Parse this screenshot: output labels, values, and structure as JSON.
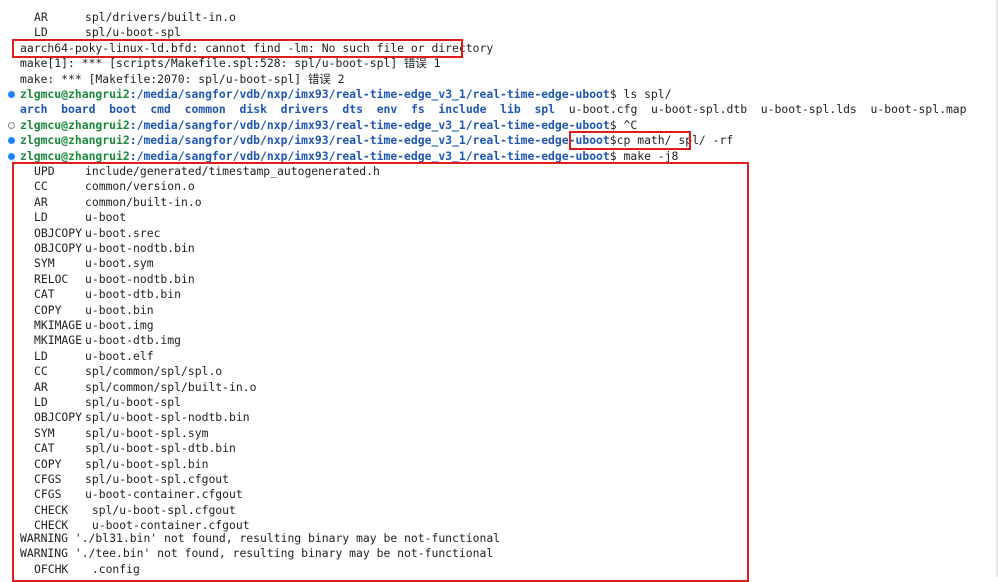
{
  "terminal": {
    "top_lines": [
      {
        "tag": "AR",
        "text": "spl/drivers/built-in.o"
      },
      {
        "tag": "LD",
        "text": "spl/u-boot-spl"
      }
    ],
    "error_line": "aarch64-poky-linux-ld.bfd: cannot find -lm: No such file or directory",
    "make_errors": [
      "make[1]: *** [scripts/Makefile.spl:528: spl/u-boot-spl] 错误 1",
      "make: *** [Makefile:2070: spl/u-boot-spl] 错误 2"
    ],
    "prompt": {
      "user_host": "zlgmcu@zhangrui2",
      "path": ":/media/sangfor/vdb/nxp/imx93/real-time-edge_v3_1/real-time-edge-uboot",
      "symbol": "$ "
    },
    "commands": {
      "ls": "ls spl/",
      "interrupt": "^C",
      "cp": "cp math/ spl/ -rf",
      "make": "make -j8"
    },
    "ls_dirs": [
      "arch",
      "board",
      "boot",
      "cmd",
      "common",
      "disk",
      "drivers",
      "dts",
      "env",
      "fs",
      "include",
      "lib",
      "spl"
    ],
    "ls_files": [
      "u-boot.cfg",
      "u-boot-spl.dtb",
      "u-boot-spl.lds",
      "u-boot-spl.map"
    ],
    "build_lines": [
      {
        "tag": "UPD",
        "text": "include/generated/timestamp_autogenerated.h"
      },
      {
        "tag": "CC",
        "text": "common/version.o"
      },
      {
        "tag": "AR",
        "text": "common/built-in.o"
      },
      {
        "tag": "LD",
        "text": "u-boot"
      },
      {
        "tag": "OBJCOPY",
        "text": "u-boot.srec"
      },
      {
        "tag": "OBJCOPY",
        "text": "u-boot-nodtb.bin"
      },
      {
        "tag": "SYM",
        "text": "u-boot.sym"
      },
      {
        "tag": "RELOC",
        "text": "u-boot-nodtb.bin"
      },
      {
        "tag": "CAT",
        "text": "u-boot-dtb.bin"
      },
      {
        "tag": "COPY",
        "text": "u-boot.bin"
      },
      {
        "tag": "MKIMAGE",
        "text": "u-boot.img"
      },
      {
        "tag": "MKIMAGE",
        "text": "u-boot-dtb.img"
      },
      {
        "tag": "LD",
        "text": "u-boot.elf"
      },
      {
        "tag": "CC",
        "text": "spl/common/spl/spl.o"
      },
      {
        "tag": "AR",
        "text": "spl/common/spl/built-in.o"
      },
      {
        "tag": "LD",
        "text": "spl/u-boot-spl"
      },
      {
        "tag": "OBJCOPY",
        "text": "spl/u-boot-spl-nodtb.bin"
      },
      {
        "tag": "SYM",
        "text": "spl/u-boot-spl.sym"
      },
      {
        "tag": "CAT",
        "text": "spl/u-boot-spl-dtb.bin"
      },
      {
        "tag": "COPY",
        "text": "spl/u-boot-spl.bin"
      },
      {
        "tag": "CFGS",
        "text": "spl/u-boot-spl.cfgout"
      },
      {
        "tag": "CFGS",
        "text": "u-boot-container.cfgout"
      },
      {
        "tag": "CHECK",
        "text": " spl/u-boot-spl.cfgout"
      },
      {
        "tag": "CHECK",
        "text": " u-boot-container.cfgout"
      }
    ],
    "warnings": [
      "WARNING './bl31.bin' not found, resulting binary may be not-functional",
      "WARNING './tee.bin' not found, resulting binary may be not-functional"
    ],
    "last_line": {
      "tag": "OFCHK",
      "text": " .config"
    },
    "colors": {
      "highlight_border": "#e01d1d",
      "user_host": "#1a8a3a",
      "path": "#1f56b5",
      "success_dot": "#1a85ff"
    }
  }
}
